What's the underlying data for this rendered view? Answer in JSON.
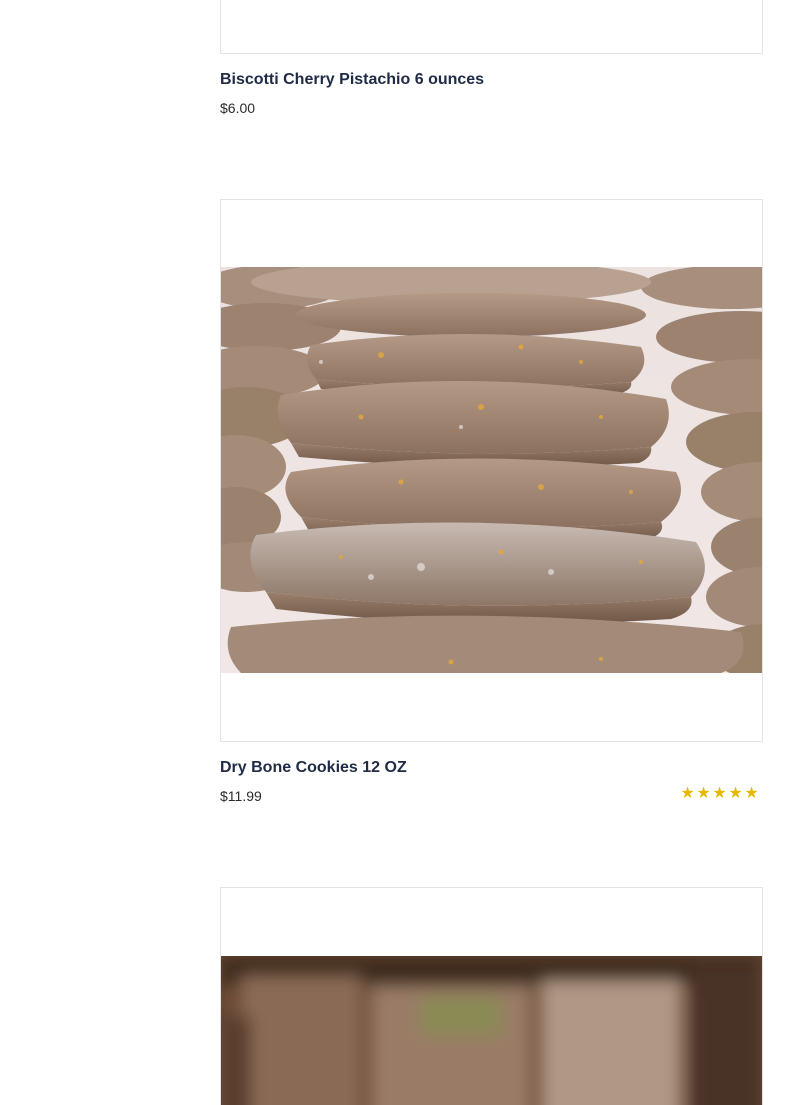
{
  "products": [
    {
      "title": "Biscotti Cherry Pistachio 6 ounces",
      "price": "$6.00"
    },
    {
      "title": "Dry Bone Cookies 12 OZ",
      "price": "$11.99",
      "rating": {
        "stars": 5,
        "max": 5
      }
    },
    {
      "title": "",
      "price": ""
    }
  ],
  "colors": {
    "star": "#e8b90a",
    "border": "#e3e3e3",
    "title": "#1f2a44"
  }
}
